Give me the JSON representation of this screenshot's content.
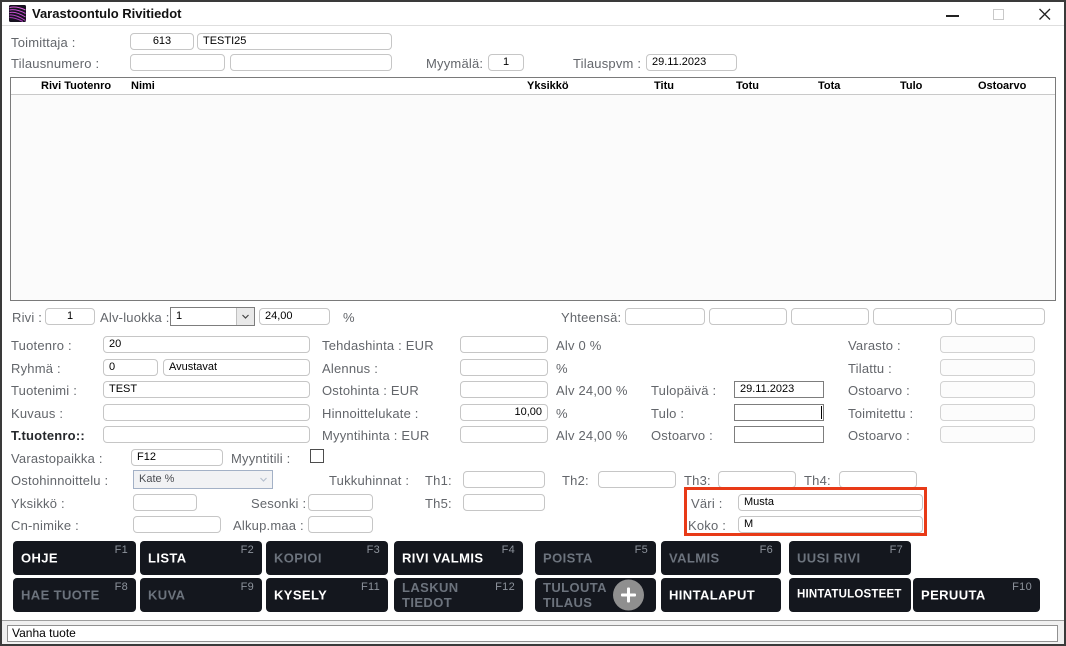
{
  "titlebar": {
    "title": "Varastoontulo Rivitiedot"
  },
  "top": {
    "toimittaja_label": "Toimittaja :",
    "toimittaja_code": "613",
    "toimittaja_name": "TESTI25",
    "tilausnumero_label": "Tilausnumero :",
    "tilausnumero_value1": "",
    "tilausnumero_value2": "",
    "myymala_label": "Myymälä:",
    "myymala_value": "1",
    "tilauspvm_label": "Tilauspvm :",
    "tilauspvm_value": "29.11.2023"
  },
  "grid": {
    "columns": [
      "Rivi Tuotenro",
      "Nimi",
      "Yksikkö",
      "Titu",
      "Totu",
      "Tota",
      "Tulo",
      "Ostoarvo"
    ],
    "rows": []
  },
  "totals": {
    "rivi_label": "Rivi :",
    "rivi_value": "1",
    "alv_luokka_label": "Alv-luokka :",
    "alv_luokka_value": "1",
    "alv_percent": "24,00",
    "percent": "%",
    "yhteensa_label": "Yhteensä:",
    "yhteensa_values": [
      "",
      "",
      "",
      "",
      ""
    ]
  },
  "form": {
    "tuotenro_label": "Tuotenro :",
    "tuotenro": "20",
    "ryhma_label": "Ryhmä :",
    "ryhma_code": "0",
    "ryhma_name": "Avustavat",
    "tuotenimi_label": "Tuotenimi :",
    "tuotenimi": "TEST",
    "kuvaus_label": "Kuvaus :",
    "kuvaus": "",
    "t_tuotenro_label": "T.tuotenro::",
    "t_tuotenro": "",
    "varastopaikka_label": "Varastopaikka :",
    "varastopaikka": "F12",
    "myyntitili_label": "Myyntitili :",
    "ostohinnoittelu_label": "Ostohinnoittelu :",
    "ostohinnoittelu": "Kate %",
    "yksikko_label": "Yksikkö :",
    "yksikko": "",
    "sesonki_label": "Sesonki :",
    "sesonki": "",
    "cn_nimike_label": "Cn-nimike :",
    "cn_nimike": "",
    "alkup_maa_label": "Alkup.maa :",
    "alkup_maa": "",
    "tehdashinta_label": "Tehdashinta : EUR",
    "tehdashinta": "",
    "tehdashinta_suffix": "Alv 0 %",
    "alennus_label": "Alennus :",
    "alennus": "",
    "alennus_suffix": "%",
    "ostohinta_label": "Ostohinta : EUR",
    "ostohinta": "",
    "ostohinta_suffix": "Alv 24,00 %",
    "hinnoittelukate_label": "Hinnoittelukate :",
    "hinnoittelukate": "10,00",
    "hinnoittelukate_suffix": "%",
    "myyntihinta_label": "Myyntihinta : EUR",
    "myyntihinta": "",
    "myyntihinta_suffix": "Alv 24,00 %",
    "tulopaiva_label": "Tulopäivä :",
    "tulopaiva": "29.11.2023",
    "tulo_label": "Tulo :",
    "tulo": "",
    "ostoarvo_mid_label": "Ostoarvo :",
    "ostoarvo_mid": "",
    "varasto_label": "Varasto :",
    "varasto": "",
    "tilattu_label": "Tilattu :",
    "tilattu": "",
    "ostoarvo1_label": "Ostoarvo :",
    "ostoarvo1": "",
    "toimitettu_label": "Toimitettu :",
    "toimitettu": "",
    "ostoarvo2_label": "Ostoarvo :",
    "ostoarvo2": "",
    "tukkuhinnat_label": "Tukkuhinnat :",
    "th1_label": "Th1:",
    "th1": "",
    "th2_label": "Th2:",
    "th2": "",
    "th3_label": "Th3:",
    "th3": "",
    "th4_label": "Th4:",
    "th4": "",
    "th5_label": "Th5:",
    "th5": "",
    "vari_label": "Väri :",
    "vari": "Musta",
    "koko_label": "Koko :",
    "koko": "M",
    "highlight_color": "#e83a17"
  },
  "buttons": {
    "row1": [
      {
        "label": "OHJE",
        "fkey": "F1",
        "enabled": true
      },
      {
        "label": "LISTA",
        "fkey": "F2",
        "enabled": true
      },
      {
        "label": "KOPIOI",
        "fkey": "F3",
        "enabled": false
      },
      {
        "label": "RIVI VALMIS",
        "fkey": "F4",
        "enabled": true
      },
      {
        "label": "POISTA",
        "fkey": "F5",
        "enabled": false
      },
      {
        "label": "VALMIS",
        "fkey": "F6",
        "enabled": false
      },
      {
        "label": "UUSI RIVI",
        "fkey": "F7",
        "enabled": false
      }
    ],
    "row2": [
      {
        "label": "HAE TUOTE",
        "fkey": "F8",
        "enabled": false
      },
      {
        "label": "KUVA",
        "fkey": "F9",
        "enabled": false
      },
      {
        "label": "KYSELY",
        "fkey": "F11",
        "enabled": true
      },
      {
        "label": "LASKUN\nTIEDOT",
        "fkey": "F12",
        "enabled": false
      },
      {
        "label": "TULOUTA\nTILAUS",
        "fkey": "",
        "enabled": false,
        "icon": "plus"
      },
      {
        "label": "HINTALAPUT",
        "fkey": "",
        "enabled": true
      },
      {
        "label": "HINTATULOSTEET",
        "fkey": "",
        "enabled": true
      },
      {
        "label": "PERUUTA",
        "fkey": "F10",
        "enabled": true
      }
    ]
  },
  "statusbar": {
    "text": "Vanha tuote"
  }
}
